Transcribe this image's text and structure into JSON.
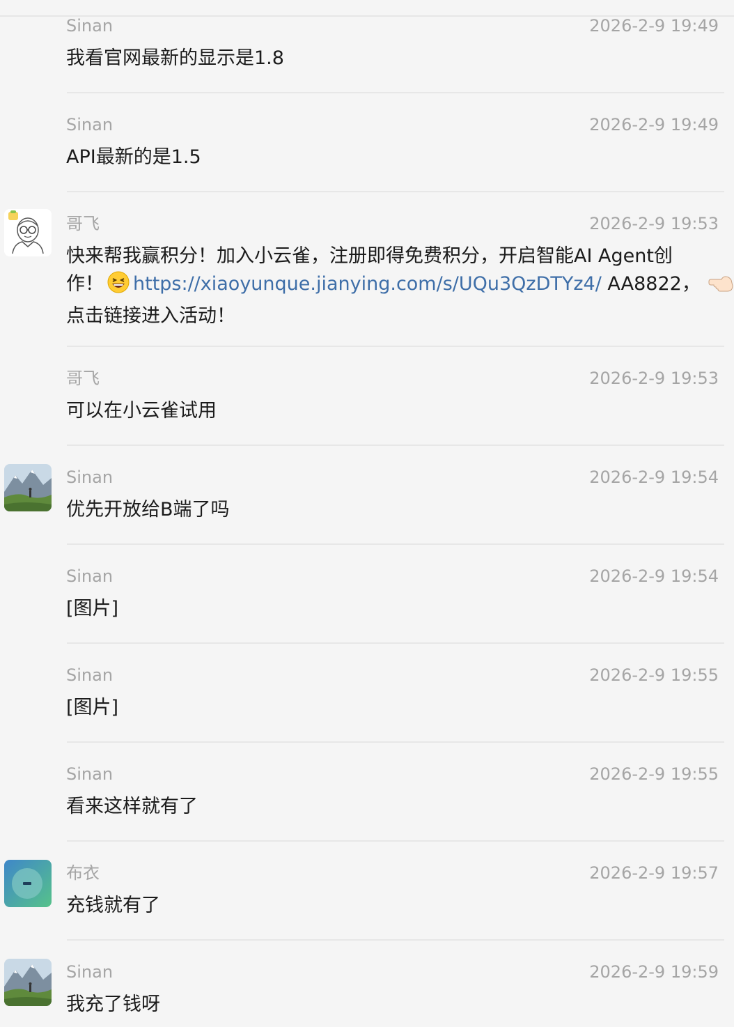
{
  "messages": [
    {
      "sender": "Sinan",
      "time": "2026-2-9 19:49",
      "text": "我看官网最新的显示是1.8"
    },
    {
      "sender": "Sinan",
      "time": "2026-2-9 19:49",
      "text": "API最新的是1.5"
    },
    {
      "sender": "哥飞",
      "time": "2026-2-9 19:53",
      "text_line1": "快来帮我赢积分！加入小云雀，注册即得免费积分，开启智能AI Agent创",
      "text_line2_prefix": "作！",
      "emoji_1": "grinning-squinting-face-icon",
      "link": "https://xiaoyunque.jianying.com/s/UQu3QzDTYz4/",
      "code_suffix": " AA8822，",
      "emoji_2": "backhand-index-pointing-left-icon",
      "text_line3": "点击链接进入活动！"
    },
    {
      "sender": "哥飞",
      "time": "2026-2-9 19:53",
      "text": "可以在小云雀试用"
    },
    {
      "sender": "Sinan",
      "time": "2026-2-9 19:54",
      "text": "优先开放给B端了吗"
    },
    {
      "sender": "Sinan",
      "time": "2026-2-9 19:54",
      "text": "[图片]"
    },
    {
      "sender": "Sinan",
      "time": "2026-2-9 19:55",
      "text": "[图片]"
    },
    {
      "sender": "Sinan",
      "time": "2026-2-9 19:55",
      "text": "看来这样就有了"
    },
    {
      "sender": "布衣",
      "time": "2026-2-9 19:57",
      "text": "充钱就有了"
    },
    {
      "sender": "Sinan",
      "time": "2026-2-9 19:59",
      "text": "我充了钱呀"
    }
  ],
  "colors": {
    "background": "#f5f5f5",
    "meta_text": "#a5a5a5",
    "body_text": "#1b1b1b",
    "link": "#3e6ea8",
    "separator": "#e7e7e7"
  }
}
